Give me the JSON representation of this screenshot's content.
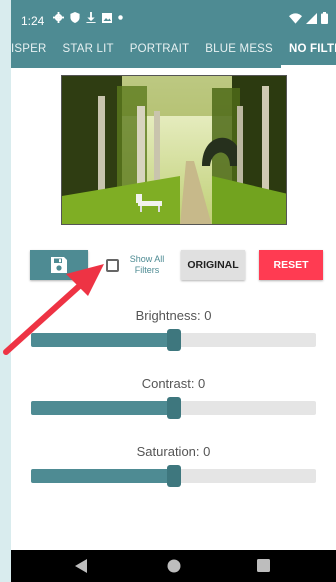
{
  "status_bar": {
    "time": "1:24"
  },
  "tabs": [
    {
      "label": "ISPER",
      "active": false
    },
    {
      "label": "STAR LIT",
      "active": false
    },
    {
      "label": "PORTRAIT",
      "active": false
    },
    {
      "label": "BLUE MESS",
      "active": false
    },
    {
      "label": "NO FILTER",
      "active": true
    }
  ],
  "controls": {
    "show_all_label": "Show All Filters",
    "original_label": "ORIGINAL",
    "reset_label": "RESET"
  },
  "sliders": [
    {
      "label": "Brightness: 0",
      "fraction": 0.5
    },
    {
      "label": "Contrast: 0",
      "fraction": 0.5
    },
    {
      "label": "Saturation: 0",
      "fraction": 0.5
    }
  ],
  "colors": {
    "accent": "#4e8b93",
    "reset": "#ff3b52",
    "annotation": "#ee3344"
  }
}
